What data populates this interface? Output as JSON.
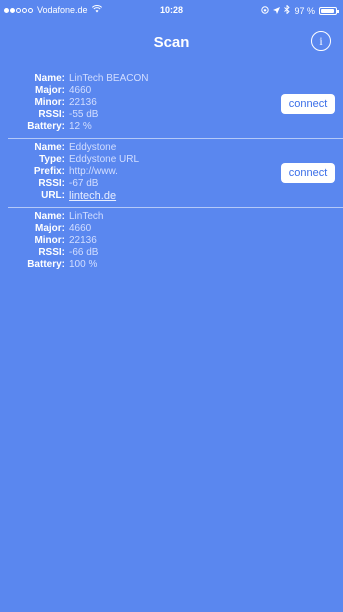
{
  "status_bar": {
    "carrier": "Vodafone.de",
    "time": "10:28",
    "battery_percent": "97 %",
    "signal_bars_filled": 2,
    "signal_bars_total": 5
  },
  "nav": {
    "title": "Scan"
  },
  "beacons": [
    {
      "rows": [
        {
          "label": "Name:",
          "value": "LinTech BEACON"
        },
        {
          "label": "Major:",
          "value": "4660"
        },
        {
          "label": "Minor:",
          "value": "22136"
        },
        {
          "label": "RSSI:",
          "value": "-55 dB"
        },
        {
          "label": "Battery:",
          "value": "12  %"
        }
      ],
      "connect_label": "connect"
    },
    {
      "rows": [
        {
          "label": "Name:",
          "value": "Eddystone"
        },
        {
          "label": "Type:",
          "value": "Eddystone URL"
        },
        {
          "label": "Prefix:",
          "value": "http://www."
        },
        {
          "label": "RSSI:",
          "value": "-67 dB"
        },
        {
          "label": "URL:",
          "value": "lintech.de"
        }
      ],
      "connect_label": "connect"
    },
    {
      "rows": [
        {
          "label": "Name:",
          "value": "LinTech"
        },
        {
          "label": "Major:",
          "value": "4660"
        },
        {
          "label": "Minor:",
          "value": "22136"
        },
        {
          "label": "RSSI:",
          "value": "-66 dB"
        },
        {
          "label": "Battery:",
          "value": "100 %"
        }
      ]
    }
  ],
  "colors": {
    "background": "#5a87ef",
    "button_text": "#3a6ee8"
  }
}
